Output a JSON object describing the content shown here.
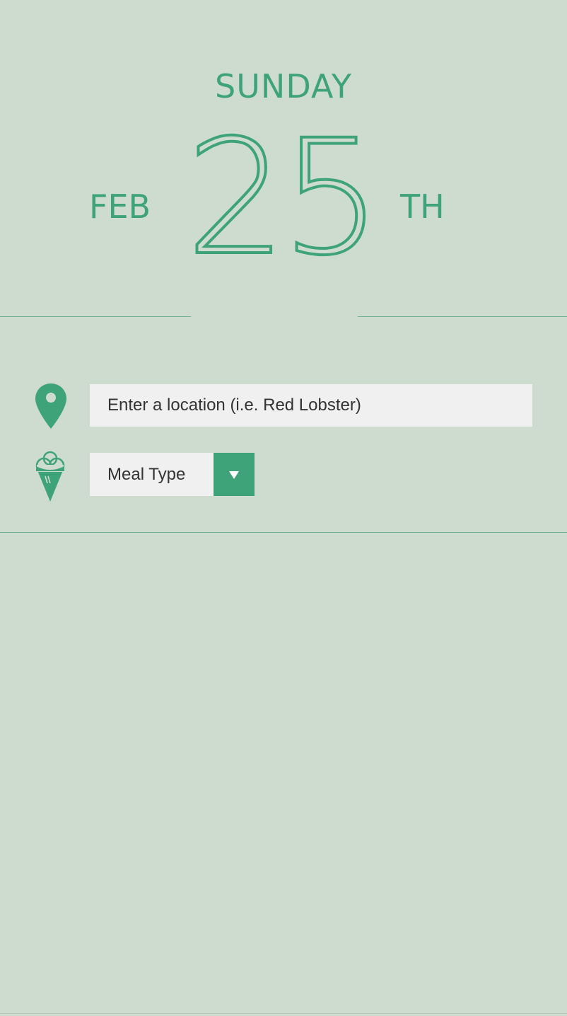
{
  "date": {
    "weekday": "SUNDAY",
    "month": "FEB",
    "day": "25",
    "suffix": "TH"
  },
  "location": {
    "placeholder": "Enter a location (i.e. Red Lobster)",
    "icon": "map-pin-icon"
  },
  "meal": {
    "label": "Meal Type",
    "icon": "ice-cream-icon",
    "arrow_icon": "chevron-down-icon"
  },
  "colors": {
    "background": "#cedccf",
    "accent": "#3fa37a",
    "field": "#f0f0f0",
    "text": "#333333",
    "divider": "#6fb28f"
  }
}
